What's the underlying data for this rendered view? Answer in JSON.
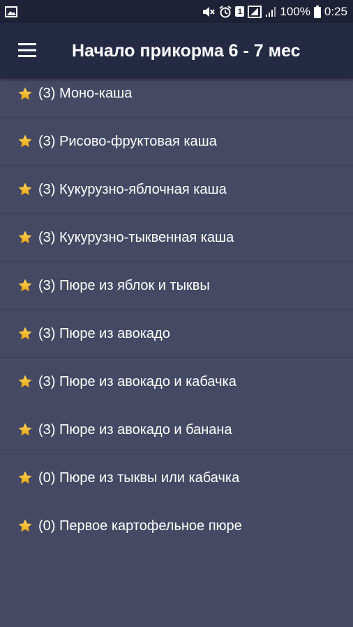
{
  "status_bar": {
    "notification_badge": "1",
    "battery_percent": "100%",
    "time": "0:25"
  },
  "app_bar": {
    "title": "Начало прикорма 6 - 7 мес"
  },
  "colors": {
    "background": "#464964",
    "app_bar": "#252a44",
    "status_bar": "#1f2236",
    "star": "#f2b71a",
    "text": "#ffffff"
  },
  "recipes": [
    {
      "label": "(3) Моно-каша",
      "icon": "star-icon"
    },
    {
      "label": "(3) Рисово-фруктовая каша",
      "icon": "star-icon"
    },
    {
      "label": "(3) Кукурузно-яблочная каша",
      "icon": "star-icon"
    },
    {
      "label": "(3) Кукурузно-тыквенная каша",
      "icon": "star-icon"
    },
    {
      "label": "(3) Пюре из яблок и тыквы",
      "icon": "star-icon"
    },
    {
      "label": "(3) Пюре из авокадо",
      "icon": "star-icon"
    },
    {
      "label": "(3) Пюре из авокадо и кабачка",
      "icon": "star-icon"
    },
    {
      "label": "(3) Пюре из авокадо и банана",
      "icon": "star-icon"
    },
    {
      "label": "(0) Пюре из тыквы или кабачка",
      "icon": "star-icon"
    },
    {
      "label": "(0) Первое картофельное пюре",
      "icon": "star-icon"
    }
  ]
}
